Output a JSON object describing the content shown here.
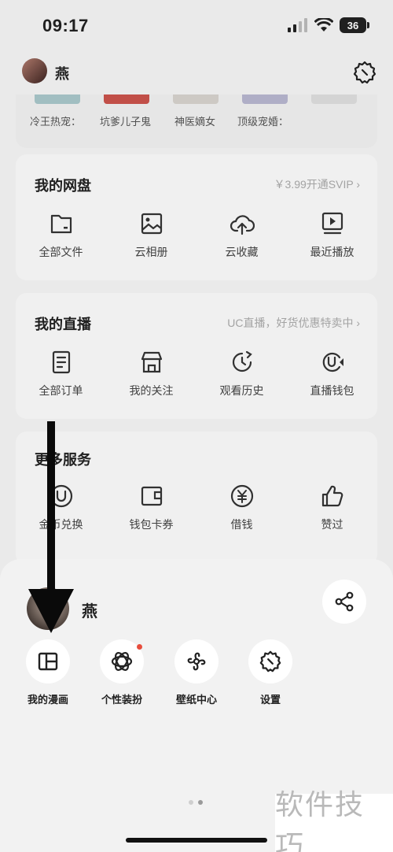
{
  "status_bar": {
    "time": "09:17",
    "battery": "36"
  },
  "header": {
    "username": "燕"
  },
  "novels": [
    "冷王热宠：",
    "坑爹儿子鬼",
    "神医嫡女",
    "顶级宠婚："
  ],
  "netdisk": {
    "title": "我的网盘",
    "link": "￥3.99开通SVIP ›",
    "items": [
      {
        "label": "全部文件",
        "icon": "folder-icon"
      },
      {
        "label": "云相册",
        "icon": "photo-icon"
      },
      {
        "label": "云收藏",
        "icon": "cloud-upload-icon"
      },
      {
        "label": "最近播放",
        "icon": "play-screen-icon"
      }
    ]
  },
  "live": {
    "title": "我的直播",
    "link": "UC直播，好货优惠特卖中 ›",
    "items": [
      {
        "label": "全部订单",
        "icon": "order-icon"
      },
      {
        "label": "我的关注",
        "icon": "store-icon"
      },
      {
        "label": "观看历史",
        "icon": "history-icon"
      },
      {
        "label": "直播钱包",
        "icon": "live-wallet-icon"
      }
    ]
  },
  "services": {
    "title": "更多服务",
    "items": [
      {
        "label": "金币兑换",
        "icon": "coin-icon"
      },
      {
        "label": "钱包卡券",
        "icon": "wallet-icon"
      },
      {
        "label": "借钱",
        "icon": "yuan-icon"
      },
      {
        "label": "赞过",
        "icon": "thumbs-up-icon"
      }
    ]
  },
  "sheet": {
    "username": "燕",
    "actions": [
      {
        "label": "我的漫画",
        "icon": "comic-icon"
      },
      {
        "label": "个性装扮",
        "icon": "theme-icon",
        "badge": true
      },
      {
        "label": "壁纸中心",
        "icon": "wallpaper-icon"
      },
      {
        "label": "设置",
        "icon": "settings-icon"
      }
    ]
  },
  "watermark": "软件技巧"
}
